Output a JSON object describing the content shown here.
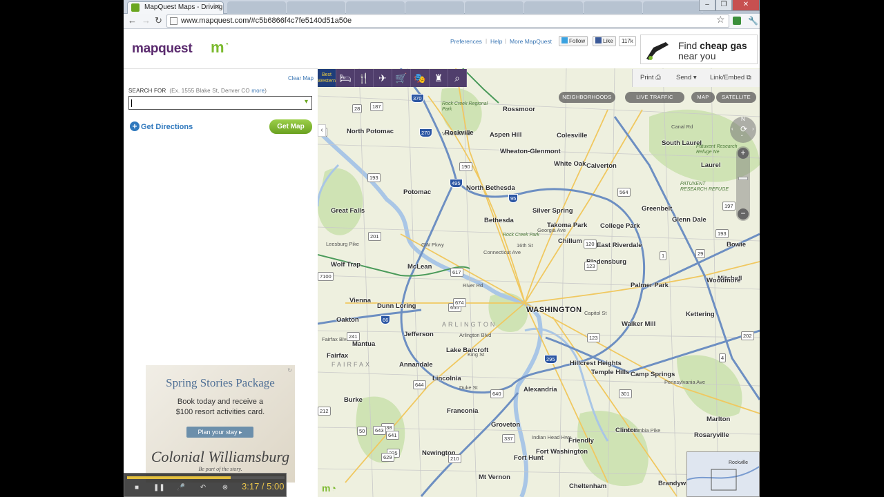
{
  "browser": {
    "active_tab_title": "MapQuest Maps - Driving D",
    "inactive_tabs": [
      "",
      "",
      "",
      "",
      "",
      "",
      "",
      "",
      ""
    ],
    "url": "www.mapquest.com/#c5b6866f4c7fe5140d51a50e"
  },
  "header": {
    "logo_text": "mapquest",
    "links": [
      "Preferences",
      "Help",
      "More MapQuest"
    ],
    "twitter_label": "Follow",
    "facebook_label": "Like",
    "facebook_count": "117k",
    "gas_ad": {
      "line1_prefix": "Find ",
      "line1_bold": "cheap gas",
      "line2": "near you"
    }
  },
  "sidebar": {
    "clear_map": "Clear Map",
    "search_label": "SEARCH FOR",
    "search_example": "(Ex. 1555 Blake St, Denver CO",
    "search_more": "more",
    "search_value": "",
    "get_directions": "Get Directions",
    "get_map": "Get Map"
  },
  "ad": {
    "heading": "Spring Stories Package",
    "body1": "Book today and receive a",
    "body2": "$100 resort activities card.",
    "button": "Plan your stay",
    "brand": "Colonial Williamsburg",
    "tagline": "Be part of the story."
  },
  "map": {
    "tools": {
      "print": "Print",
      "send": "Send",
      "link": "Link/Embed"
    },
    "layer_pills": [
      "NEIGHBORHOODS",
      "LIVE TRAFFIC",
      "MAP",
      "SATELLITE"
    ],
    "categories": [
      "best-western-icon",
      "hotel-icon",
      "food-icon",
      "travel-icon",
      "shopping-icon",
      "entertainment-icon",
      "attractions-icon",
      "search-icon"
    ],
    "best_western": "Best Western",
    "places": [
      {
        "name": "WASHINGTON",
        "big": true
      },
      {
        "name": "Rockville"
      },
      {
        "name": "Aspen Hill"
      },
      {
        "name": "Wheaton-Glenmont"
      },
      {
        "name": "North Potomac"
      },
      {
        "name": "Potomac"
      },
      {
        "name": "North Bethesda"
      },
      {
        "name": "Bethesda"
      },
      {
        "name": "Silver Spring"
      },
      {
        "name": "Takoma Park"
      },
      {
        "name": "College Park"
      },
      {
        "name": "Chillum"
      },
      {
        "name": "Bladensburg"
      },
      {
        "name": "Greenbelt"
      },
      {
        "name": "McLean"
      },
      {
        "name": "Vienna"
      },
      {
        "name": "Dunn Loring"
      },
      {
        "name": "Oakton"
      },
      {
        "name": "Jefferson"
      },
      {
        "name": "Annandale"
      },
      {
        "name": "Lincolnia"
      },
      {
        "name": "Alexandria"
      },
      {
        "name": "Burke"
      },
      {
        "name": "Franconia"
      },
      {
        "name": "Groveton"
      },
      {
        "name": "Newington"
      },
      {
        "name": "Fort Hunt"
      },
      {
        "name": "Mt Vernon"
      },
      {
        "name": "Fort Washington"
      },
      {
        "name": "Friendly"
      },
      {
        "name": "Clinton"
      },
      {
        "name": "Temple Hills"
      },
      {
        "name": "Hillcrest Heights"
      },
      {
        "name": "Camp Springs"
      },
      {
        "name": "Walker Mill"
      },
      {
        "name": "Palmer Park"
      },
      {
        "name": "Kettering"
      },
      {
        "name": "East Riverdale"
      },
      {
        "name": "Calverton"
      },
      {
        "name": "White Oak"
      },
      {
        "name": "Colesville"
      },
      {
        "name": "Rossmoor"
      },
      {
        "name": "South Laurel"
      },
      {
        "name": "Laurel"
      },
      {
        "name": "Glenn Dale"
      },
      {
        "name": "Great Falls"
      },
      {
        "name": "Wolf Trap"
      },
      {
        "name": "Mantua"
      },
      {
        "name": "Fairfax"
      },
      {
        "name": "Lake Barcroft"
      },
      {
        "name": "Marlton"
      },
      {
        "name": "Rosaryville"
      },
      {
        "name": "Cheltenham"
      },
      {
        "name": "Mitchell"
      },
      {
        "name": "Bowie"
      },
      {
        "name": "Woodmore"
      },
      {
        "name": "Brandywine"
      }
    ],
    "water_labels": [
      "Potomac River",
      "ARLINGTON",
      "FAIRFAX"
    ],
    "park_labels": [
      "Rock Creek Regional Park",
      "Rock Creek Park",
      "Patuxent Research Refuge Ne",
      "PATUXENT RESEARCH REFUGE"
    ],
    "road_labels": [
      "Capitol St",
      "GW Pkwy",
      "Georgia Ave",
      "Connecticut Ave",
      "16th St",
      "King St",
      "Duke St",
      "Arlington Blvd",
      "Fairfax Blvd",
      "Leesburg Pike",
      "Pennsylvania Ave",
      "Indian Head Hwy",
      "Veirs Mill Rd",
      "River Rd",
      "Canal Rd",
      "Columbia Pike",
      "Branch Ave"
    ],
    "shields": [
      "370",
      "270",
      "495",
      "95",
      "66",
      "295",
      "28",
      "187",
      "190",
      "193",
      "201",
      "564",
      "197",
      "193",
      "1",
      "29",
      "123",
      "120",
      "655",
      "617",
      "241",
      "644",
      "640",
      "638",
      "643",
      "641",
      "235",
      "629",
      "210",
      "337",
      "301",
      "202",
      "4",
      "123",
      "674",
      "7100",
      "212",
      "28",
      "50"
    ],
    "compass_n": "N",
    "mini_label": "Rockville"
  },
  "player": {
    "time": "3:17 / 5:00",
    "progress": 0.66
  }
}
